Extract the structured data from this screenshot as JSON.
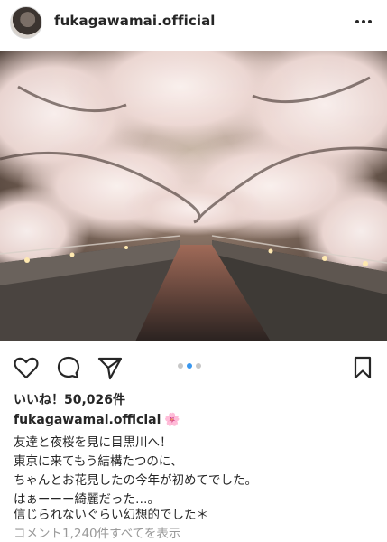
{
  "post": {
    "username": "fukagawamai.official",
    "likes": "いいね！50,026件",
    "caption_username": "fukagawamai.official",
    "caption_emoji": "🌸",
    "caption_lines": [
      "友達と夜桜を見に目黒川へ！",
      "東京に来てもう結構たつのに、",
      "ちゃんとお花見したの今年が初めてでした。",
      "はぁーーー綺麗だった…。",
      "信じられないぐらい幻想的でした＊"
    ],
    "comments_link": "コメント1,240件すべてを表示"
  },
  "carousel": {
    "count": 3,
    "active": 2
  },
  "icons": {
    "more": "more-options-icon",
    "like": "heart-icon",
    "comment": "comment-icon",
    "share": "send-icon",
    "save": "bookmark-icon"
  },
  "colors": {
    "active_dot": "#3897f0",
    "inactive_dot": "#c7c7c7",
    "text": "#262626",
    "muted": "#999999"
  }
}
